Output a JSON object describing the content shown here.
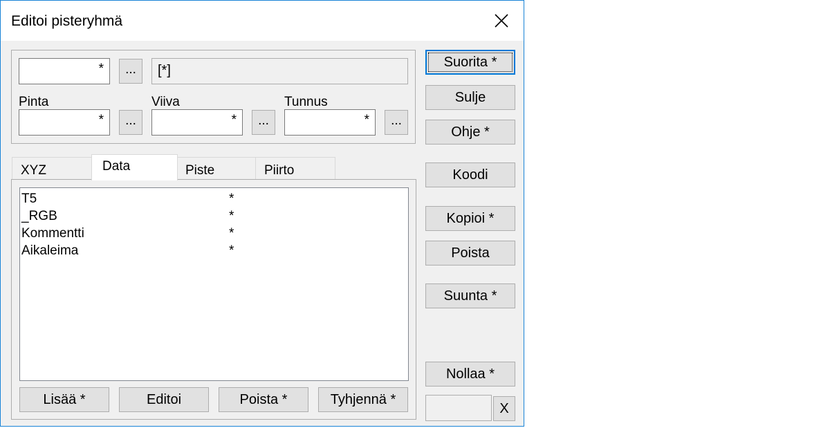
{
  "window": {
    "title": "Editoi pisteryhmä"
  },
  "top_group": {
    "field1": {
      "value": "*"
    },
    "dots_label": "...",
    "readonly_value": "[*]",
    "pinta": {
      "label": "Pinta",
      "value": "*"
    },
    "viiva": {
      "label": "Viiva",
      "value": "*"
    },
    "tunnus": {
      "label": "Tunnus",
      "value": "*"
    }
  },
  "tabs": [
    {
      "label": "XYZ"
    },
    {
      "label": "Data"
    },
    {
      "label": "Piste"
    },
    {
      "label": "Piirto"
    }
  ],
  "data_list": [
    {
      "name": "T5",
      "value": "*"
    },
    {
      "name": "_RGB",
      "value": "*"
    },
    {
      "name": "Kommentti",
      "value": "*"
    },
    {
      "name": "Aikaleima",
      "value": "*"
    }
  ],
  "bottom_buttons": {
    "add": "Lisää *",
    "edit": "Editoi",
    "delete": "Poista *",
    "clear": "Tyhjennä *"
  },
  "side_buttons": {
    "run": "Suorita *",
    "close": "Sulje",
    "help": "Ohje *",
    "code": "Koodi",
    "copy": "Kopioi *",
    "delete": "Poista",
    "direction": "Suunta *",
    "reset": "Nollaa *",
    "x": "X"
  }
}
